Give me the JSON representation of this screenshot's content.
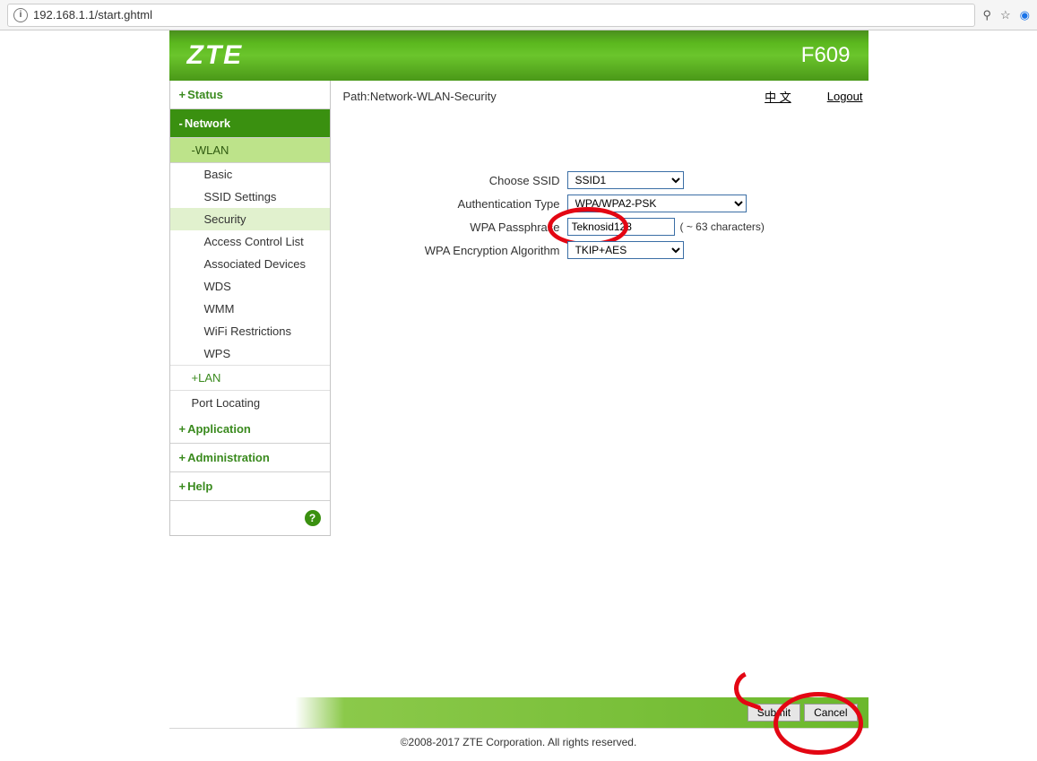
{
  "browser": {
    "url": "192.168.1.1/start.ghtml"
  },
  "header": {
    "brand": "ZTE",
    "model": "F609"
  },
  "sidebar": {
    "status": "Status",
    "network": "Network",
    "wlan": "WLAN",
    "wlan_items": {
      "basic": "Basic",
      "ssid": "SSID Settings",
      "security": "Security",
      "acl": "Access Control List",
      "assoc": "Associated Devices",
      "wds": "WDS",
      "wmm": "WMM",
      "wifir": "WiFi Restrictions",
      "wps": "WPS"
    },
    "lan": "LAN",
    "port_locating": "Port Locating",
    "application": "Application",
    "administration": "Administration",
    "help": "Help"
  },
  "topbar": {
    "path_label": "Path:",
    "path_value": "Network-WLAN-Security",
    "lang": "中 文",
    "logout": "Logout"
  },
  "form": {
    "choose_ssid_label": "Choose SSID",
    "choose_ssid_value": "SSID1",
    "auth_type_label": "Authentication Type",
    "auth_type_value": "WPA/WPA2-PSK",
    "wpa_pass_label": "WPA Passphrase",
    "wpa_pass_value": "Teknosid123",
    "wpa_pass_note": "( ~ 63 characters)",
    "wpa_enc_label": "WPA Encryption Algorithm",
    "wpa_enc_value": "TKIP+AES"
  },
  "buttons": {
    "submit": "Submit",
    "cancel": "Cancel"
  },
  "footer": {
    "copyright": "©2008-2017 ZTE Corporation. All rights reserved."
  }
}
